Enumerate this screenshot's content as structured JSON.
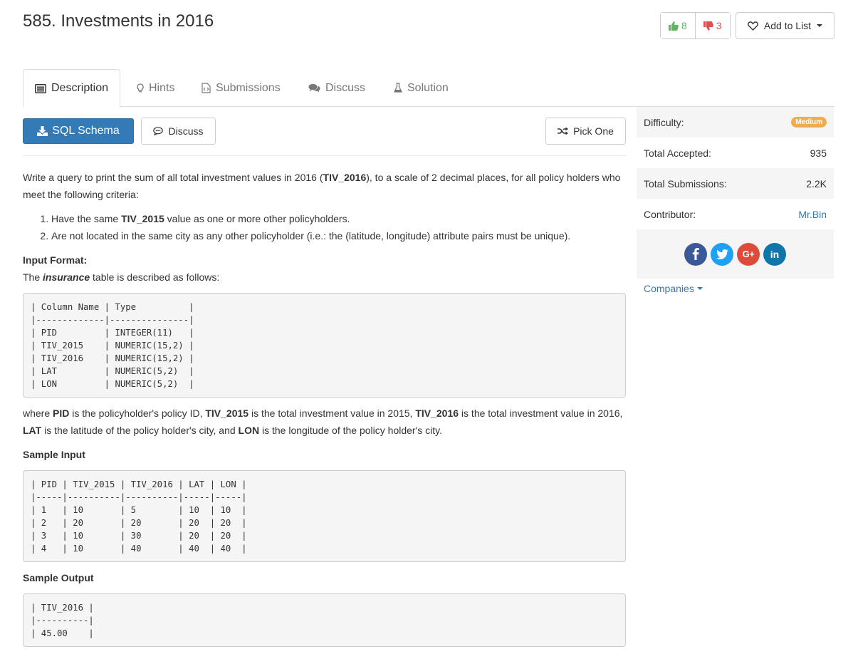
{
  "problem": {
    "title": "585. Investments in 2016",
    "likes": "8",
    "dislikes": "3",
    "add_to_list": "Add to List"
  },
  "tabs": [
    {
      "label": "Description",
      "icon": "description-icon",
      "active": true
    },
    {
      "label": "Hints",
      "icon": "lightbulb-icon"
    },
    {
      "label": "Submissions",
      "icon": "code-file-icon"
    },
    {
      "label": "Discuss",
      "icon": "comments-icon"
    },
    {
      "label": "Solution",
      "icon": "flask-icon"
    }
  ],
  "toolbar": {
    "sql_schema": "SQL Schema",
    "discuss": "Discuss",
    "pick_one": "Pick One"
  },
  "description": {
    "intro_a": "Write a query to print the sum of all total investment values in 2016 (",
    "intro_b": "TIV_2016",
    "intro_c": "), to a scale of 2 decimal places, for all policy holders who meet the following criteria:",
    "c1_a": "Have the same ",
    "c1_b": "TIV_2015",
    "c1_c": " value as one or more other policyholders.",
    "c2": "Are not located in the same city as any other policyholder (i.e.: the (latitude, longitude) attribute pairs must be unique).",
    "input_format_heading": "Input Format:",
    "table_desc_a": "The ",
    "table_desc_b": "insurance",
    "table_desc_c": " table is described as follows:",
    "schema_block": "| Column Name | Type          |\n|-------------|---------------|\n| PID         | INTEGER(11)   |\n| TIV_2015    | NUMERIC(15,2) |\n| TIV_2016    | NUMERIC(15,2) |\n| LAT         | NUMERIC(5,2)  |\n| LON         | NUMERIC(5,2)  |",
    "where_1": "where ",
    "where_pid": "PID",
    "where_2": " is the policyholder's policy ID, ",
    "where_tiv15": "TIV_2015",
    "where_3": " is the total investment value in 2015, ",
    "where_tiv16": "TIV_2016",
    "where_4": " is the total investment value in 2016, ",
    "where_lat": "LAT",
    "where_5": " is the latitude of the policy holder's city, and ",
    "where_lon": "LON",
    "where_6": " is the longitude of the policy holder's city.",
    "sample_input_heading": "Sample Input",
    "sample_input_block": "| PID | TIV_2015 | TIV_2016 | LAT | LON |\n|-----|----------|----------|-----|-----|\n| 1   | 10       | 5        | 10  | 10  |\n| 2   | 20       | 20       | 20  | 20  |\n| 3   | 10       | 30       | 20  | 20  |\n| 4   | 10       | 40       | 40  | 40  |",
    "sample_output_heading": "Sample Output",
    "sample_output_block": "| TIV_2016 |\n|----------|\n| 45.00    |"
  },
  "sidebar": {
    "difficulty_label": "Difficulty:",
    "difficulty_value": "Medium",
    "accepted_label": "Total Accepted:",
    "accepted_value": "935",
    "submissions_label": "Total Submissions:",
    "submissions_value": "2.2K",
    "contributor_label": "Contributor:",
    "contributor_value": "Mr.Bin",
    "companies": "Companies",
    "social": [
      {
        "name": "facebook-icon",
        "glyph": "f",
        "color": "#3b5998"
      },
      {
        "name": "twitter-icon",
        "glyph": "",
        "color": "#1da1f2"
      },
      {
        "name": "google-plus-icon",
        "glyph": "G+",
        "color": "#dd4b39"
      },
      {
        "name": "linkedin-icon",
        "glyph": "in",
        "color": "#0e76a8"
      }
    ]
  },
  "colors": {
    "primary": "#337ab7",
    "like": "#5cb85c",
    "dislike": "#d9534f",
    "medium_badge": "#f0ad4e"
  }
}
